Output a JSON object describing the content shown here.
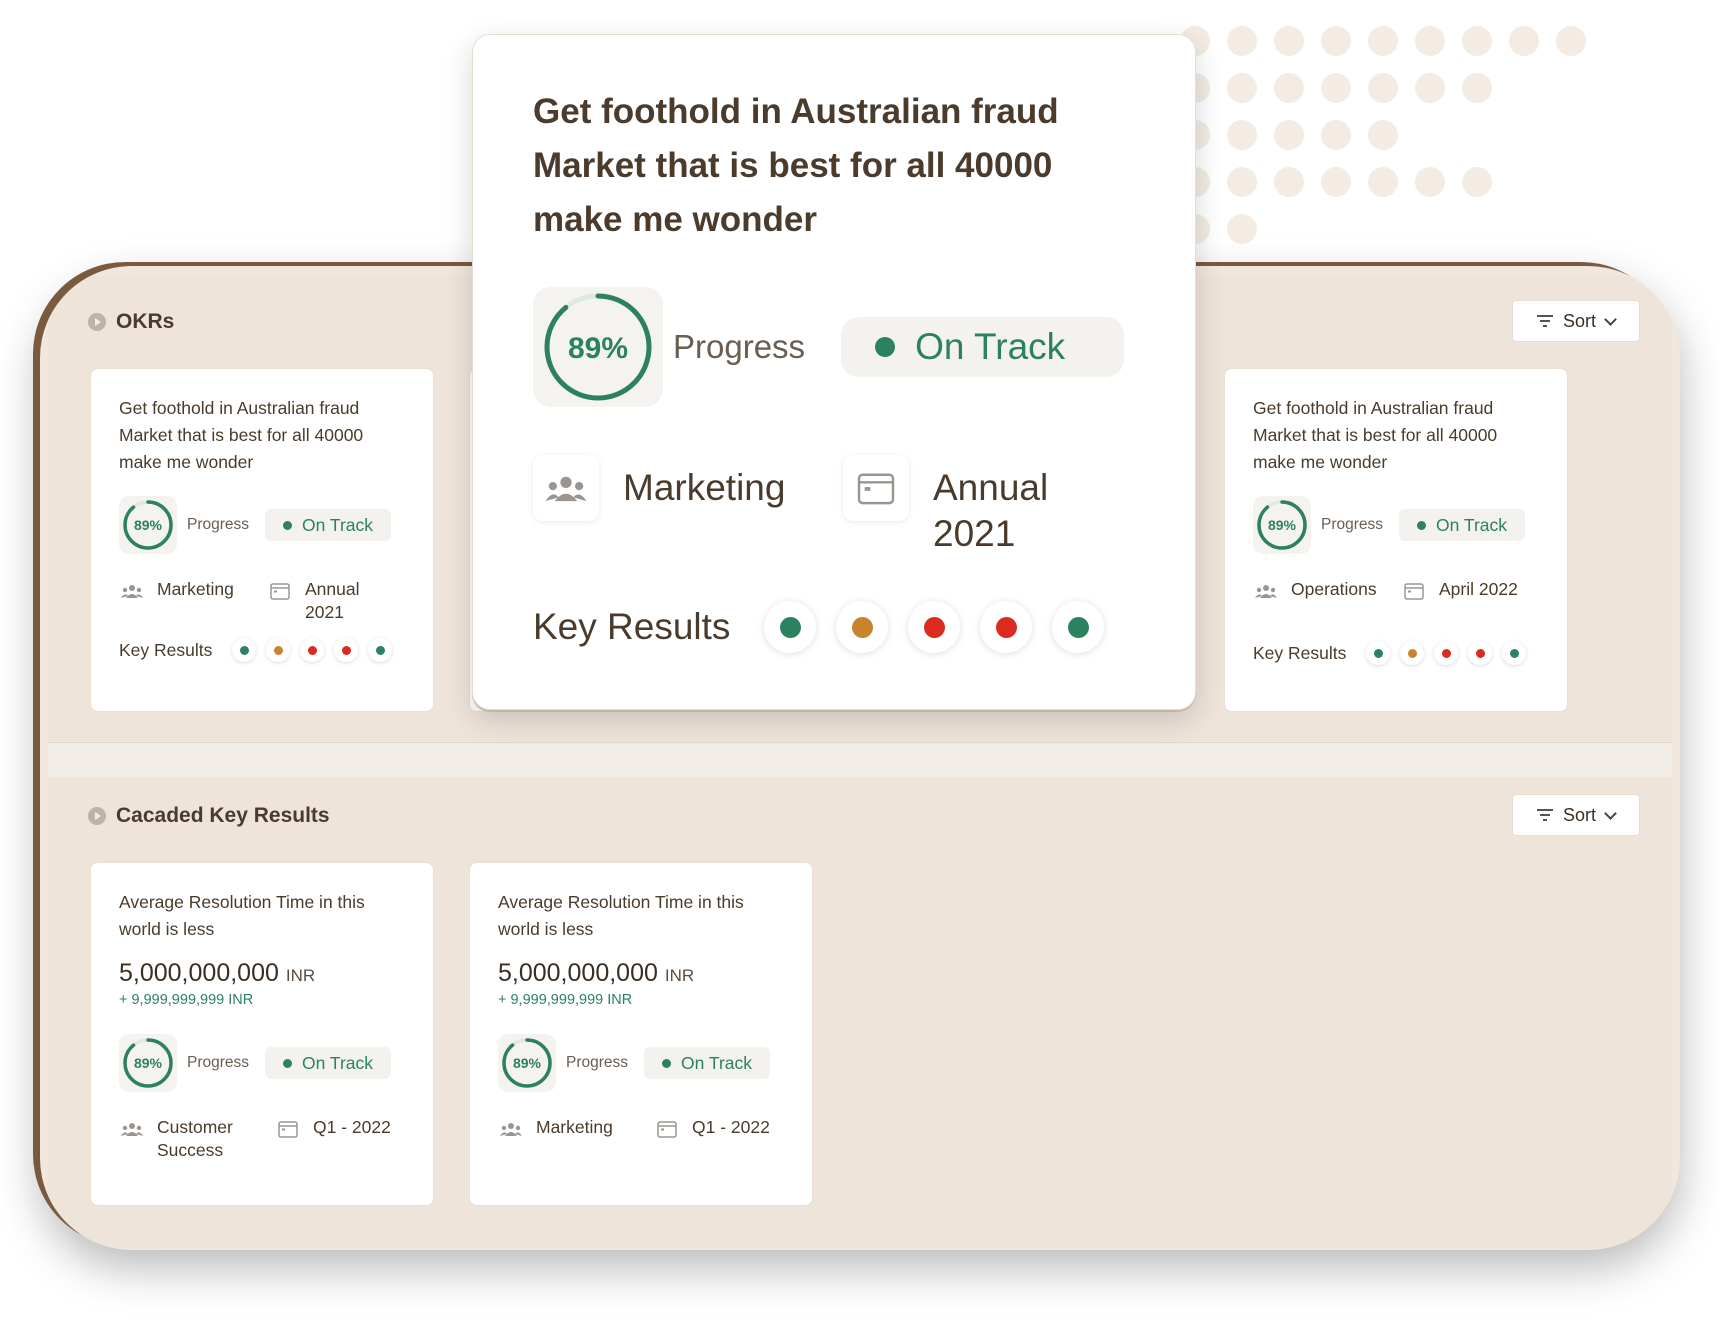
{
  "colors": {
    "green": "#2c8160",
    "orange": "#c7842c",
    "red": "#dd2a1e",
    "ring_track": "#dfe9e4"
  },
  "okr_section": {
    "title": "OKRs",
    "sort_label": "Sort",
    "cards": [
      {
        "title": "Get foothold in Australian fraud Market that is best for all 40000 make  me wonder",
        "progress_pct": 89,
        "progress_text": "89%",
        "progress_label": "Progress",
        "status": "On Track",
        "team": "Marketing",
        "period_line1": "Annual",
        "period_line2": "2021",
        "kr_label": "Key Results",
        "key_results": [
          "green",
          "orange",
          "red",
          "red",
          "green"
        ]
      },
      {
        "title": "Get foothold in Australian fraud Market that is best for all 40000 make  me wonder",
        "progress_pct": 89,
        "progress_text": "89%",
        "progress_label": "Progress",
        "status": "On Track",
        "team": "Operations",
        "period_line1": "April 2022",
        "kr_label": "Key Results",
        "key_results": [
          "green",
          "orange",
          "red",
          "red",
          "green"
        ]
      }
    ]
  },
  "popup": {
    "title": "Get foothold in Australian fraud Market that is best for all 40000 make  me wonder",
    "progress_pct": 89,
    "progress_text": "89%",
    "progress_label": "Progress",
    "status": "On Track",
    "team": "Marketing",
    "period_line1": "Annual",
    "period_line2": "2021",
    "kr_label": "Key Results",
    "key_results": [
      "green",
      "orange",
      "red",
      "red",
      "green"
    ]
  },
  "kr_section": {
    "title": "Cacaded Key Results",
    "sort_label": "Sort",
    "cards": [
      {
        "title": "Average Resolution Time in this world is less",
        "amount": "5,000,000,000",
        "currency": "INR",
        "delta": "+ 9,999,999,999 INR",
        "progress_pct": 89,
        "progress_text": "89%",
        "progress_label": "Progress",
        "status": "On Track",
        "team_line1": "Customer",
        "team_line2": "Success",
        "period": "Q1 - 2022"
      },
      {
        "title": "Average Resolution Time in this world is less",
        "amount": "5,000,000,000",
        "currency": "INR",
        "delta": "+ 9,999,999,999 INR",
        "progress_pct": 89,
        "progress_text": "89%",
        "progress_label": "Progress",
        "status": "On Track",
        "team_line1": "Marketing",
        "period": "Q1 - 2022"
      }
    ]
  }
}
